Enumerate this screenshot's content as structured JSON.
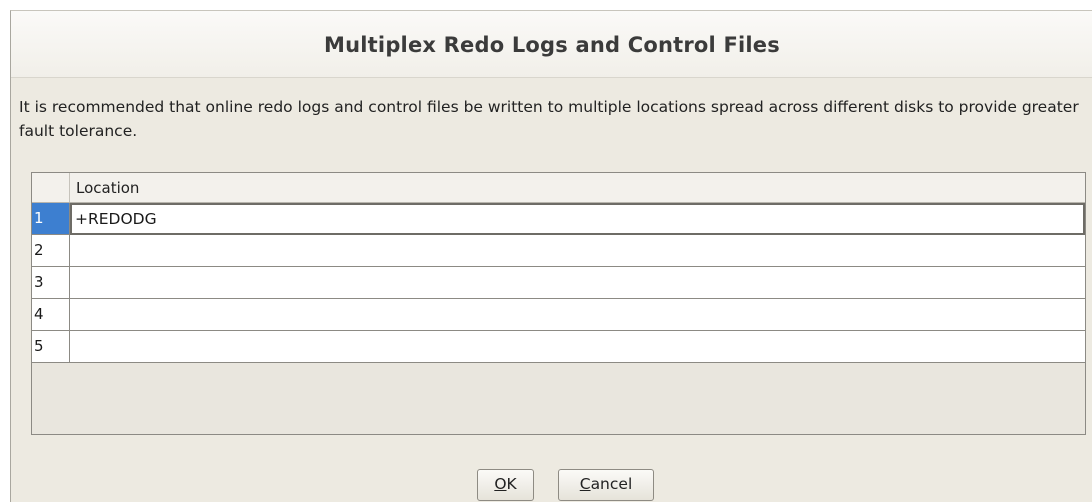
{
  "dialog": {
    "title": "Multiplex Redo Logs and Control Files",
    "description": "It is recommended that online redo logs and control files be  written to multiple locations spread across different disks to provide greater fault tolerance."
  },
  "table": {
    "column_header": "Location",
    "rows": [
      {
        "num": "1",
        "location": "+REDODG"
      },
      {
        "num": "2",
        "location": ""
      },
      {
        "num": "3",
        "location": ""
      },
      {
        "num": "4",
        "location": ""
      },
      {
        "num": "5",
        "location": ""
      }
    ],
    "selected_row": "1"
  },
  "buttons": {
    "ok": {
      "mnemonic": "O",
      "rest": "K"
    },
    "cancel": {
      "mnemonic": "C",
      "rest": "ancel"
    }
  },
  "colors": {
    "dialog_bg": "#edeae1",
    "selection": "#3d7fd0"
  }
}
